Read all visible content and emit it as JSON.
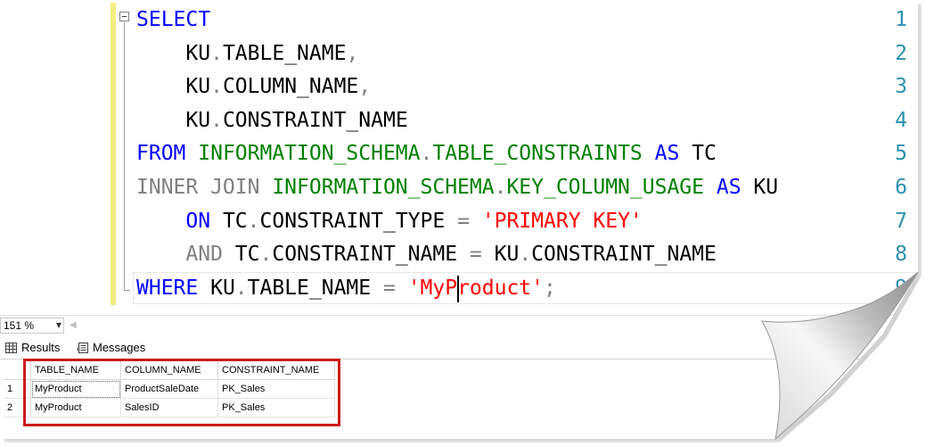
{
  "editor": {
    "line_numbers": [
      "1",
      "2",
      "3",
      "4",
      "5",
      "6",
      "7",
      "8",
      "9"
    ],
    "lines": [
      [
        {
          "t": "SELECT",
          "c": "kw"
        }
      ],
      [
        {
          "t": "    KU",
          "c": ""
        },
        {
          "t": ".",
          "c": "gr"
        },
        {
          "t": "TABLE_NAME",
          "c": ""
        },
        {
          "t": ",",
          "c": "gr"
        }
      ],
      [
        {
          "t": "    KU",
          "c": ""
        },
        {
          "t": ".",
          "c": "gr"
        },
        {
          "t": "COLUMN_NAME",
          "c": ""
        },
        {
          "t": ",",
          "c": "gr"
        }
      ],
      [
        {
          "t": "    KU",
          "c": ""
        },
        {
          "t": ".",
          "c": "gr"
        },
        {
          "t": "CONSTRAINT_NAME",
          "c": ""
        }
      ],
      [
        {
          "t": "FROM ",
          "c": "kw"
        },
        {
          "t": "INFORMATION_SCHEMA",
          "c": "sys"
        },
        {
          "t": ".",
          "c": "gr"
        },
        {
          "t": "TABLE_CONSTRAINTS",
          "c": "sys"
        },
        {
          "t": " AS ",
          "c": "kw"
        },
        {
          "t": "TC",
          "c": ""
        }
      ],
      [
        {
          "t": "INNER JOIN ",
          "c": "gr"
        },
        {
          "t": "INFORMATION_SCHEMA",
          "c": "sys"
        },
        {
          "t": ".",
          "c": "gr"
        },
        {
          "t": "KEY_COLUMN_USAGE",
          "c": "sys"
        },
        {
          "t": " AS ",
          "c": "kw"
        },
        {
          "t": "KU",
          "c": ""
        }
      ],
      [
        {
          "t": "    ON ",
          "c": "kw"
        },
        {
          "t": "TC",
          "c": ""
        },
        {
          "t": ".",
          "c": "gr"
        },
        {
          "t": "CONSTRAINT_TYPE ",
          "c": ""
        },
        {
          "t": "= ",
          "c": "gr"
        },
        {
          "t": "'PRIMARY KEY'",
          "c": "str"
        }
      ],
      [
        {
          "t": "    AND ",
          "c": "gr"
        },
        {
          "t": "TC",
          "c": ""
        },
        {
          "t": ".",
          "c": "gr"
        },
        {
          "t": "CONSTRAINT_NAME ",
          "c": ""
        },
        {
          "t": "= ",
          "c": "gr"
        },
        {
          "t": "KU",
          "c": ""
        },
        {
          "t": ".",
          "c": "gr"
        },
        {
          "t": "CONSTRAINT_NAME",
          "c": ""
        }
      ],
      [
        {
          "t": "WHERE ",
          "c": "kw"
        },
        {
          "t": "KU",
          "c": ""
        },
        {
          "t": ".",
          "c": "gr"
        },
        {
          "t": "TABLE_NAME ",
          "c": ""
        },
        {
          "t": "= ",
          "c": "gr"
        },
        {
          "t": "'MyProduct'",
          "c": "str"
        },
        {
          "t": ";",
          "c": "gr"
        }
      ]
    ],
    "caret": {
      "line": 9,
      "column": 27
    }
  },
  "zoom": {
    "value": "151 %"
  },
  "tabs": {
    "results_label": "Results",
    "messages_label": "Messages"
  },
  "results": {
    "columns": [
      "TABLE_NAME",
      "COLUMN_NAME",
      "CONSTRAINT_NAME"
    ],
    "rows": [
      {
        "num": "1",
        "cells": [
          "MyProduct",
          "ProductSaleDate",
          "PK_Sales"
        ]
      },
      {
        "num": "2",
        "cells": [
          "MyProduct",
          "SalesID",
          "PK_Sales"
        ]
      }
    ],
    "highlight_color": "#cc1b1b"
  },
  "colors": {
    "keyword": "#0000ff",
    "operator": "#808080",
    "system_object": "#008000",
    "string": "#ff0000",
    "line_number": "#2b91af",
    "change_bar": "#f4ed81"
  }
}
